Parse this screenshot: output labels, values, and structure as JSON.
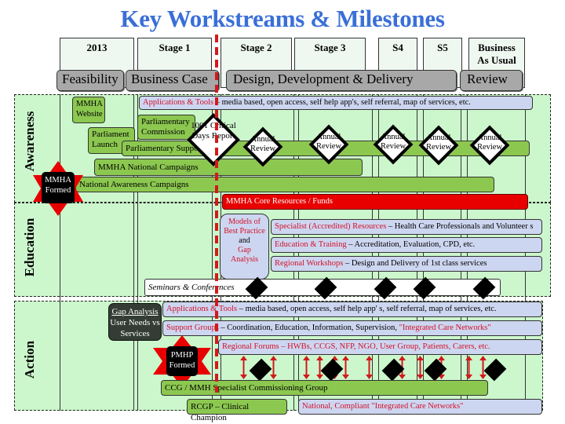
{
  "title": "Key Workstreams & Milestones",
  "stages": [
    "2013",
    "Stage 1",
    "Stage 2",
    "Stage 3",
    "S4",
    "S5",
    "Business As Usual"
  ],
  "phases": [
    "Feasibility",
    "Business Case",
    "Design, Development & Delivery",
    "Review"
  ],
  "lanes": [
    "Awareness",
    "Education",
    "Action"
  ],
  "awareness": {
    "apps_tools_red": "Applications & Tools",
    "apps_tools_rest": " – media based, open access, self help app's, self referral, map of services, etc.",
    "mmha_website": "MMHA Website",
    "parliament_launch": "Parliament Launch",
    "parliamentary_commission": "Parliamentary Commission",
    "parliamentary_support": "Parliamentary Support",
    "critical_days_report": "1001 Critical Days Report",
    "annual_review": "Annual Review",
    "annual_review_count": 5,
    "national_campaigns": "MMHA National Campaigns",
    "mmha_formed": "MMHA Formed",
    "national_awareness": "National Awareness Campaigns",
    "core_resources": "MMHA Core Resources / Funds"
  },
  "education": {
    "models_best_practice_1": "Models of Best Practice",
    "models_best_practice_and": "and",
    "models_best_practice_2": "Gap Analysis",
    "specialist_red": "Specialist (Accredited) Resources",
    "specialist_rest": " – Health Care Professionals and Volunteer s",
    "training_red": "Education & Training",
    "training_rest": " – Accreditation, Evaluation, CPD, etc.",
    "workshops_red": "Regional Workshops",
    "workshops_rest": " – Design and Delivery of 1st class services",
    "seminars": "Seminars & Conferences"
  },
  "action": {
    "gap_analysis_title": "Gap Analysis",
    "gap_analysis_body": "User Needs vs Services",
    "apps_tools_red": "Applications & Tools",
    "apps_tools_rest": " – media based, open access, self help app' s, self referral, map of services, etc.",
    "support_red": "Support Groups",
    "support_rest": " – Coordination, Education, Information, Supervision, ",
    "support_red2": "\"Integrated Care Networks\"",
    "pmhp_formed": "PMHP Formed",
    "regional_forums": "Regional Forums – HWBs, CCGS, NFP, NGO, User Group, Patients, Carers, etc.",
    "ccg_group": "CCG / MMH Specialist Commissioning Group",
    "rcgp": "RCGP – Clinical Champion",
    "national_networks": "National, Compliant \"Integrated Care Networks\""
  },
  "colors": {
    "title": "#3a6fd8",
    "lane_bg": "#ccf7cc",
    "green_box": "#8cc850",
    "blue_box": "#cdd6f0",
    "red_bar": "#e80000",
    "today_line": "#d21a1a"
  }
}
